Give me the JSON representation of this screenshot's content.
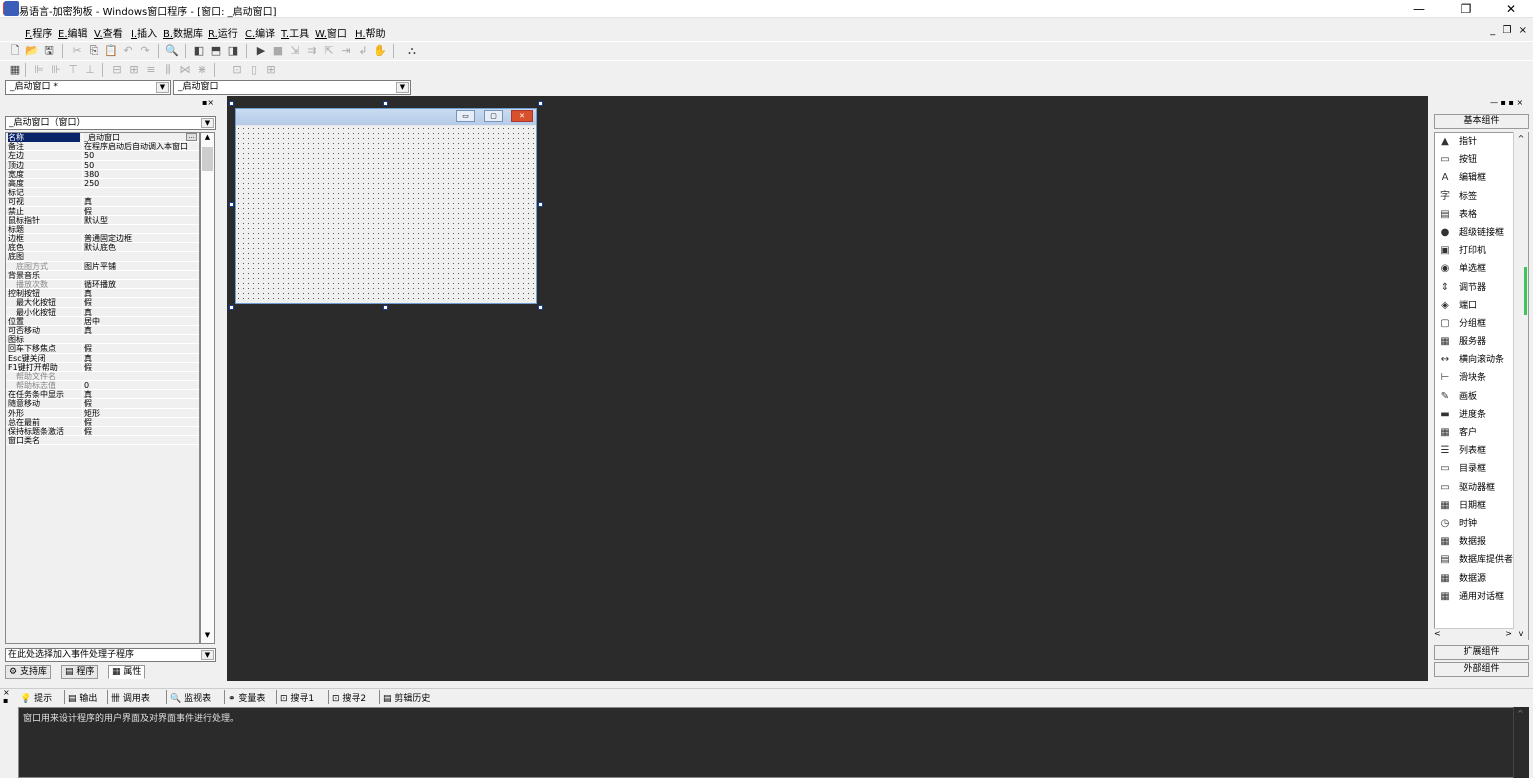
{
  "titlebar": {
    "title": "易语言-加密狗板 - Windows窗口程序 - [窗口: _启动窗口]",
    "minimize": "—",
    "maximize": "❐",
    "close": "✕"
  },
  "menu": {
    "items": [
      {
        "key": "F.",
        "label": "程序"
      },
      {
        "key": "E.",
        "label": "编辑"
      },
      {
        "key": "V.",
        "label": "查看"
      },
      {
        "key": "I.",
        "label": "插入"
      },
      {
        "key": "B.",
        "label": "数据库"
      },
      {
        "key": "R.",
        "label": "运行"
      },
      {
        "key": "C.",
        "label": "编译"
      },
      {
        "key": "T.",
        "label": "工具"
      },
      {
        "key": "W.",
        "label": "窗口"
      },
      {
        "key": "H.",
        "label": "帮助"
      }
    ],
    "mdi_controls": "_ ❐ ×"
  },
  "selectors": {
    "window_combo": "_启动窗口 *",
    "component_combo": "_启动窗口"
  },
  "properties_panel": {
    "object_selector": "_启动窗口（窗口）",
    "rows": [
      {
        "name": "名称",
        "value": "_启动窗口",
        "selected": true
      },
      {
        "name": "备注",
        "value": "在程序启动后自动调入本窗口"
      },
      {
        "name": "左边",
        "value": "50"
      },
      {
        "name": "顶边",
        "value": "50"
      },
      {
        "name": "宽度",
        "value": "380"
      },
      {
        "name": "高度",
        "value": "250"
      },
      {
        "name": "标记",
        "value": ""
      },
      {
        "name": "可视",
        "value": "真"
      },
      {
        "name": "禁止",
        "value": "假"
      },
      {
        "name": "鼠标指针",
        "value": "默认型"
      },
      {
        "name": "标题",
        "value": ""
      },
      {
        "name": "边框",
        "value": "普通固定边框"
      },
      {
        "name": "底色",
        "value": "默认底色"
      },
      {
        "name": "底图",
        "value": ""
      },
      {
        "name": "底图方式",
        "value": "图片平铺",
        "dim": true
      },
      {
        "name": "背景音乐",
        "value": ""
      },
      {
        "name": "播放次数",
        "value": "循环播放",
        "dim": true
      },
      {
        "name": "控制按钮",
        "value": "真"
      },
      {
        "name": "最大化按钮",
        "value": "假",
        "sub": true
      },
      {
        "name": "最小化按钮",
        "value": "真",
        "sub": true
      },
      {
        "name": "位置",
        "value": "居中"
      },
      {
        "name": "可否移动",
        "value": "真"
      },
      {
        "name": "图标",
        "value": ""
      },
      {
        "name": "回车下移焦点",
        "value": "假"
      },
      {
        "name": "Esc键关闭",
        "value": "真"
      },
      {
        "name": "F1键打开帮助",
        "value": "假"
      },
      {
        "name": "帮助文件名",
        "value": "",
        "dim": true
      },
      {
        "name": "帮助标志值",
        "value": "0",
        "dim": true
      },
      {
        "name": "在任务条中显示",
        "value": "真"
      },
      {
        "name": "随意移动",
        "value": "假"
      },
      {
        "name": "外形",
        "value": "矩形"
      },
      {
        "name": "总在最前",
        "value": "假"
      },
      {
        "name": "保持标题条激活",
        "value": "假"
      },
      {
        "name": "窗口类名",
        "value": ""
      }
    ],
    "event_selector": "在此处选择加入事件处理子程序",
    "tabs": [
      "支持库",
      "程序",
      "属性"
    ]
  },
  "components_panel": {
    "header": "基本组件",
    "items": [
      {
        "icon": "▲",
        "label": "指针"
      },
      {
        "icon": "▭",
        "label": "按钮"
      },
      {
        "icon": "A",
        "label": "编辑框"
      },
      {
        "icon": "字",
        "label": "标签"
      },
      {
        "icon": "▤",
        "label": "表格"
      },
      {
        "icon": "●",
        "label": "超级链接框"
      },
      {
        "icon": "▣",
        "label": "打印机"
      },
      {
        "icon": "◉",
        "label": "单选框"
      },
      {
        "icon": "⇕",
        "label": "调节器"
      },
      {
        "icon": "◈",
        "label": "端口"
      },
      {
        "icon": "▢",
        "label": "分组框"
      },
      {
        "icon": "▦",
        "label": "服务器"
      },
      {
        "icon": "↔",
        "label": "横向滚动条"
      },
      {
        "icon": "⊢",
        "label": "滑块条"
      },
      {
        "icon": "✎",
        "label": "画板"
      },
      {
        "icon": "▬",
        "label": "进度条"
      },
      {
        "icon": "▦",
        "label": "客户"
      },
      {
        "icon": "☰",
        "label": "列表框"
      },
      {
        "icon": "▭",
        "label": "目录框"
      },
      {
        "icon": "▭",
        "label": "驱动器框"
      },
      {
        "icon": "▦",
        "label": "日期框"
      },
      {
        "icon": "◷",
        "label": "时钟"
      },
      {
        "icon": "▦",
        "label": "数据报"
      },
      {
        "icon": "▤",
        "label": "数据库提供者"
      },
      {
        "icon": "▦",
        "label": "数据源"
      },
      {
        "icon": "▦",
        "label": "通用对话框"
      }
    ],
    "extended": "扩展组件",
    "external": "外部组件"
  },
  "bottom_tabs": [
    "提示",
    "输出",
    "调用表",
    "监视表",
    "变量表",
    "搜寻1",
    "搜寻2",
    "剪辑历史"
  ],
  "output_text": "窗口用来设计程序的用户界面及对界面事件进行处理。"
}
